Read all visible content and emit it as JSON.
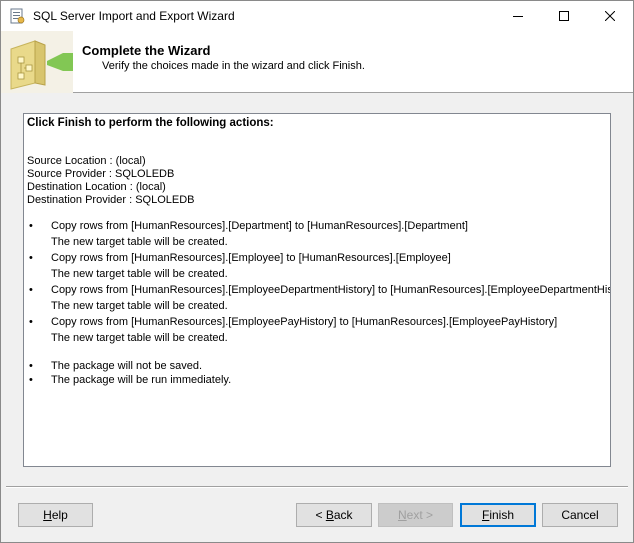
{
  "window": {
    "title": "SQL Server Import and Export Wizard"
  },
  "header": {
    "title": "Complete the Wizard",
    "subtitle": "Verify the choices made in the wizard and click Finish."
  },
  "summary": {
    "heading": "Click Finish to perform the following actions:",
    "locations": [
      "Source Location : (local)",
      "Source Provider : SQLOLEDB",
      "Destination Location : (local)",
      "Destination Provider : SQLOLEDB"
    ],
    "actions": [
      {
        "copy": "Copy rows from [HumanResources].[Department] to [HumanResources].[Department]",
        "note": "The new target table will be created."
      },
      {
        "copy": "Copy rows from [HumanResources].[Employee] to [HumanResources].[Employee]",
        "note": "The new target table will be created."
      },
      {
        "copy": "Copy rows from [HumanResources].[EmployeeDepartmentHistory] to [HumanResources].[EmployeeDepartmentHistory]",
        "note": "The new target table will be created."
      },
      {
        "copy": "Copy rows from [HumanResources].[EmployeePayHistory] to [HumanResources].[EmployeePayHistory]",
        "note": "The new target table will be created."
      }
    ],
    "notes": [
      "The package will not be saved.",
      "The package will be run immediately."
    ],
    "bullet": "•"
  },
  "buttons": {
    "help": {
      "pre": "",
      "mnemonic": "H",
      "post": "elp"
    },
    "back": {
      "pre": "< ",
      "mnemonic": "B",
      "post": "ack"
    },
    "next": {
      "pre": "",
      "mnemonic": "N",
      "post": "ext >"
    },
    "finish": {
      "pre": "",
      "mnemonic": "F",
      "post": "inish"
    },
    "cancel": {
      "pre": "",
      "mnemonic": "",
      "post": "Cancel"
    }
  },
  "icons": {
    "app": "wizard-app-icon",
    "header": "wizard-header-graphic",
    "minimize": "minimize-icon",
    "maximize": "maximize-icon",
    "close": "close-icon"
  },
  "colors": {
    "window_bg": "#f0f0f0",
    "default_button_border": "#0078d7",
    "disabled_text": "#a0a0a0",
    "header_arrow": "#6dbf3a"
  }
}
